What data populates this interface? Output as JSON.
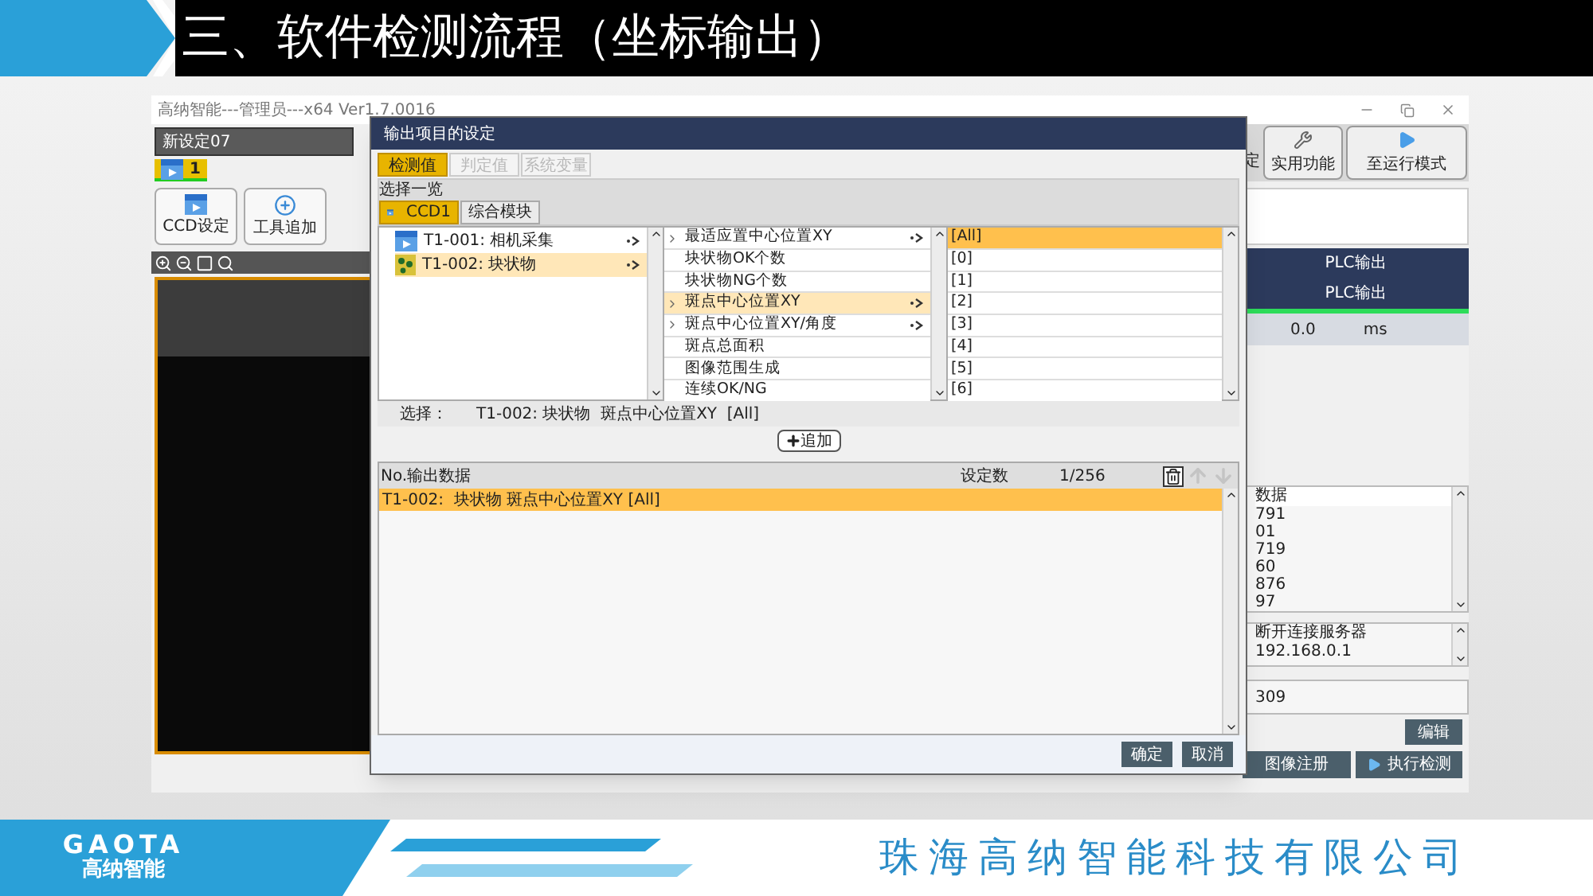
{
  "slide": {
    "title": "三、软件检测流程（坐标输出）",
    "logo_text": "GAOTA",
    "logo_subtitle": "高纳智能",
    "company": "珠海高纳智能科技有限公司"
  },
  "app": {
    "title": "高纳智能---管理员---x64 Ver1.7.0016",
    "setting_combo": "新设定07",
    "page_tab": "1",
    "tool_buttons": [
      {
        "label": "CCD设定",
        "kind": "camera"
      },
      {
        "label": "工具追加",
        "kind": "add"
      }
    ],
    "top_buttons": [
      {
        "label": "定",
        "kind": "clipped"
      },
      {
        "label": "实用功能",
        "kind": "tools"
      },
      {
        "label": "至运行模式",
        "kind": "play"
      }
    ],
    "plc_headers": [
      "PLC输出",
      "PLC输出"
    ],
    "time_value": "0.0",
    "time_unit": "ms",
    "data_header": "数据",
    "data_rows": [
      "791",
      "01",
      "719",
      "60",
      "876",
      "97"
    ],
    "log": "断开连接服务器 192.168.0.1",
    "counter": "309",
    "edit_button": "编辑",
    "bottom_buttons": [
      "图像注册",
      "执行检测"
    ]
  },
  "dialog": {
    "title": "输出项目的设定",
    "tabs": [
      {
        "label": "检测值",
        "selected": true,
        "disabled": false
      },
      {
        "label": "判定值",
        "selected": false,
        "disabled": true
      },
      {
        "label": "系统变量",
        "selected": false,
        "disabled": true
      }
    ],
    "section_label": "选择一览",
    "ccd_tabs": [
      {
        "label": "CCD1",
        "selected": true,
        "kind": "camera"
      },
      {
        "label": "综合模块",
        "selected": false,
        "kind": "text"
      }
    ],
    "tools": [
      {
        "label": "T1-001: 相机采集",
        "selected": false,
        "kind": "camera"
      },
      {
        "label": "T1-002: 块状物",
        "selected": true,
        "kind": "blob"
      }
    ],
    "items": [
      {
        "label": "最适应置中心位置XY",
        "selected": false,
        "expandable": true
      },
      {
        "label": "块状物OK个数",
        "selected": false,
        "expandable": false
      },
      {
        "label": "块状物NG个数",
        "selected": false,
        "expandable": false
      },
      {
        "label": "斑点中心位置XY",
        "selected": true,
        "expandable": true
      },
      {
        "label": "斑点中心位置XY/角度",
        "selected": false,
        "expandable": true
      },
      {
        "label": "斑点总面积",
        "selected": false,
        "expandable": false
      },
      {
        "label": "图像范围生成",
        "selected": false,
        "expandable": false
      },
      {
        "label": "连续OK/NG",
        "selected": false,
        "expandable": false
      }
    ],
    "indices": [
      {
        "label": "[All]",
        "selected": true
      },
      {
        "label": "[0]",
        "selected": false
      },
      {
        "label": "[1]",
        "selected": false
      },
      {
        "label": "[2]",
        "selected": false
      },
      {
        "label": "[3]",
        "selected": false
      },
      {
        "label": "[4]",
        "selected": false
      },
      {
        "label": "[5]",
        "selected": false
      },
      {
        "label": "[6]",
        "selected": false
      }
    ],
    "selection_label": "选择：",
    "selection_value": "T1-002: 块状物  斑点中心位置XY  [All]",
    "add_button": "追加",
    "output_header": {
      "column_1": "No.输出数据",
      "column_2": "设定数",
      "column_3": "1/256"
    },
    "output_rows": [
      {
        "label": "T1-002:  块状物 斑点中心位置XY [All]",
        "selected": true
      }
    ],
    "ok_button": "确定",
    "cancel_button": "取消"
  }
}
